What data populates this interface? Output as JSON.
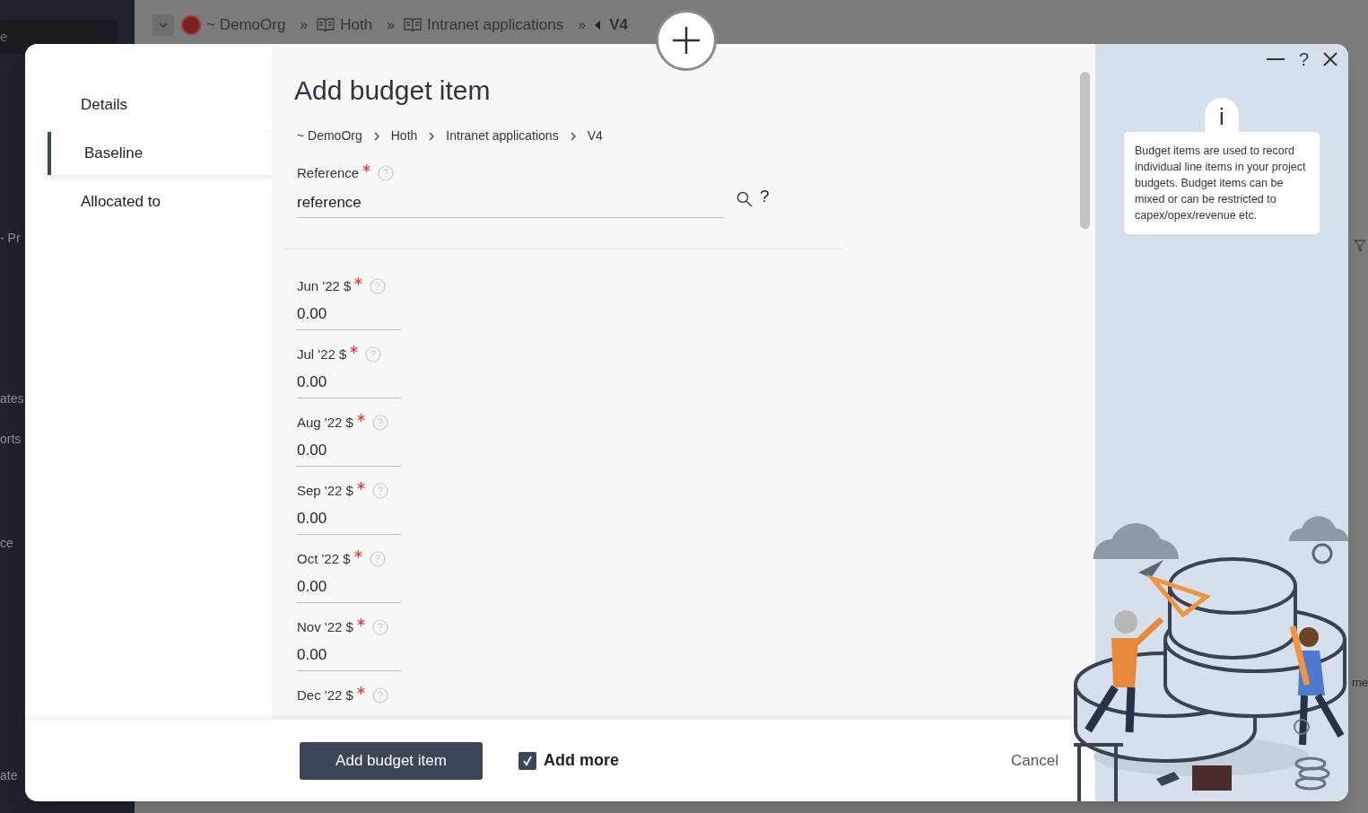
{
  "background": {
    "breadcrumb": [
      {
        "label": "~ DemoOrg",
        "kind": "org"
      },
      {
        "label": "Hoth",
        "kind": "book"
      },
      {
        "label": "Intranet applications",
        "kind": "book"
      },
      {
        "label": "V4",
        "kind": "version"
      }
    ],
    "separator": "»",
    "search_placeholder": "e",
    "sidebar_fragments": [
      "- Pr",
      "ates",
      "orts",
      "ce",
      "ate"
    ],
    "right_fragments": [
      "me"
    ]
  },
  "dialog": {
    "nav": [
      {
        "label": "Details",
        "selected": false
      },
      {
        "label": "Baseline",
        "selected": true
      },
      {
        "label": "Allocated to",
        "selected": false
      }
    ],
    "title": "Add budget item",
    "breadcrumb": [
      "~ DemoOrg",
      "Hoth",
      "Intranet applications",
      "V4"
    ],
    "reference": {
      "label": "Reference",
      "required": true,
      "value": "reference",
      "help": "?"
    },
    "fields": [
      {
        "label": "Jun '22 $",
        "required": true,
        "value": "0.00"
      },
      {
        "label": "Jul '22 $",
        "required": true,
        "value": "0.00"
      },
      {
        "label": "Aug '22 $",
        "required": true,
        "value": "0.00"
      },
      {
        "label": "Sep '22 $",
        "required": true,
        "value": "0.00"
      },
      {
        "label": "Oct '22 $",
        "required": true,
        "value": "0.00"
      },
      {
        "label": "Nov '22 $",
        "required": true,
        "value": "0.00"
      },
      {
        "label": "Dec '22 $",
        "required": true
      }
    ],
    "submit": "Add budget item",
    "add_more": {
      "label": "Add more",
      "checked": true
    },
    "cancel": "Cancel",
    "help_panel": {
      "info_icon": "i",
      "text": "Budget items are used to record individual line items in your project budgets. Budget items can be mixed or can be restricted to capex/opex/revenue etc.",
      "help": "?"
    }
  }
}
